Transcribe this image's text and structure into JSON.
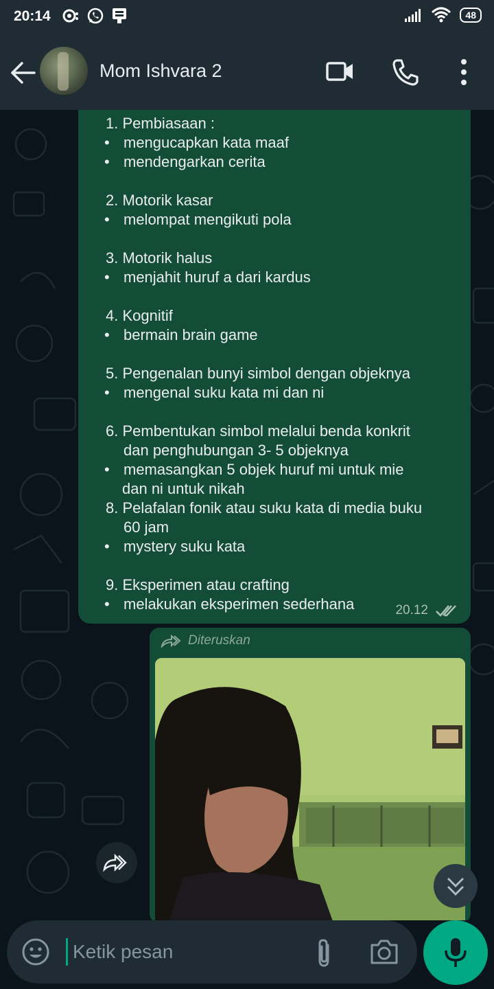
{
  "status_bar": {
    "time": "20:14",
    "battery": "48",
    "icons": [
      "notification-icon",
      "whatsapp-icon",
      "sim-icon",
      "signal-icon",
      "wifi-icon",
      "battery-icon"
    ]
  },
  "header": {
    "contact_name": "Mom Ishvara 2",
    "icons": [
      "back-arrow-icon",
      "avatar",
      "video-call-icon",
      "voice-call-icon",
      "more-options-icon"
    ]
  },
  "message": {
    "lines": [
      {
        "kind": "num",
        "text": "1. Pembiasaan :"
      },
      {
        "kind": "bullet",
        "text": "mengucapkan kata maaf"
      },
      {
        "kind": "bullet",
        "text": "mendengarkan cerita"
      },
      {
        "kind": "blank",
        "text": ""
      },
      {
        "kind": "num",
        "text": "2. Motorik kasar"
      },
      {
        "kind": "bullet",
        "text": "melompat mengikuti pola"
      },
      {
        "kind": "blank",
        "text": ""
      },
      {
        "kind": "num",
        "text": "3. Motorik halus"
      },
      {
        "kind": "bullet",
        "text": "menjahit huruf a dari kardus"
      },
      {
        "kind": "blank",
        "text": ""
      },
      {
        "kind": "num",
        "text": "4. Kognitif"
      },
      {
        "kind": "bullet",
        "text": "bermain brain game"
      },
      {
        "kind": "blank",
        "text": ""
      },
      {
        "kind": "num",
        "text": "5. Pengenalan bunyi simbol dengan objeknya"
      },
      {
        "kind": "bullet",
        "text": "mengenal suku kata mi dan ni"
      },
      {
        "kind": "blank",
        "text": ""
      },
      {
        "kind": "num",
        "text": "6. Pembentukan simbol melalui benda konkrit"
      },
      {
        "kind": "cont",
        "text": "dan penghubungan 3- 5 objeknya"
      },
      {
        "kind": "bullet",
        "text": "memasangkan 5 objek huruf mi untuk mie"
      },
      {
        "kind": "cont2",
        "text": "dan ni untuk nikah"
      },
      {
        "kind": "num",
        "text": "8. Pelafalan fonik atau suku kata di media buku"
      },
      {
        "kind": "cont",
        "text": "60 jam"
      },
      {
        "kind": "bullet",
        "text": "mystery suku kata"
      },
      {
        "kind": "blank",
        "text": ""
      },
      {
        "kind": "num",
        "text": "9. Eksperimen atau crafting"
      },
      {
        "kind": "bullet",
        "text": "melakukan eksperimen sederhana"
      }
    ],
    "time": "20.12",
    "status": "read"
  },
  "forwarded": {
    "label": "Diteruskan"
  },
  "composer": {
    "placeholder": "Ketik pesan"
  },
  "colors": {
    "bubble_out": "#144d37",
    "accent": "#00a884",
    "header_bg": "#1f2c34",
    "chat_bg": "#0b141a"
  }
}
